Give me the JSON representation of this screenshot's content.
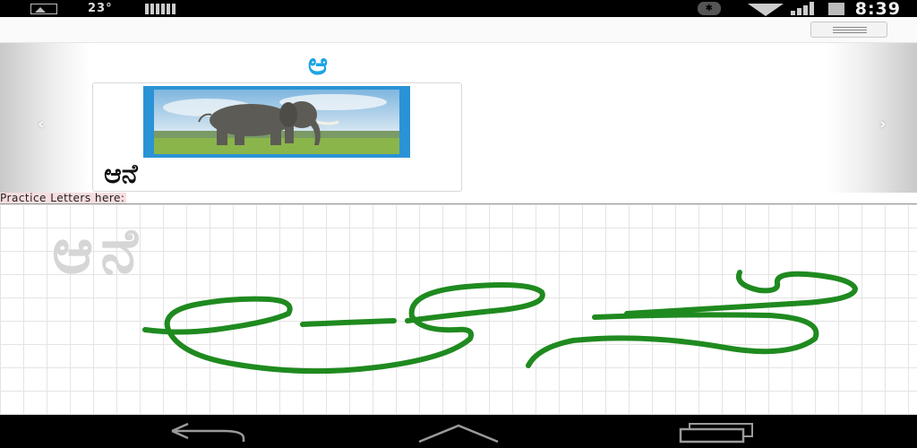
{
  "status_bar": {
    "temperature": "23°",
    "time": "8:39",
    "icons": [
      "image-icon",
      "battery-bars-icon",
      "bluetooth-icon",
      "wifi-icon",
      "signal-icon",
      "battery-icon"
    ]
  },
  "action_bar": {
    "menu_icon": "menu-lines-icon"
  },
  "lesson": {
    "letter": "ಆ",
    "word": "ಆನೆ",
    "prev_arrow": "‹",
    "next_arrow": "›",
    "image_subject": "elephant"
  },
  "practice": {
    "label": "Practice Letters here:",
    "guide_text": "ಆನೆ",
    "stroke_color": "#1f8a1f"
  },
  "navigation_bar": {
    "icons": [
      "back-icon",
      "home-icon",
      "recent-apps-icon"
    ]
  },
  "colors": {
    "accent": "#1ca4e6",
    "image_border": "#2a93d5",
    "practice_label_bg": "#f7dde0"
  }
}
